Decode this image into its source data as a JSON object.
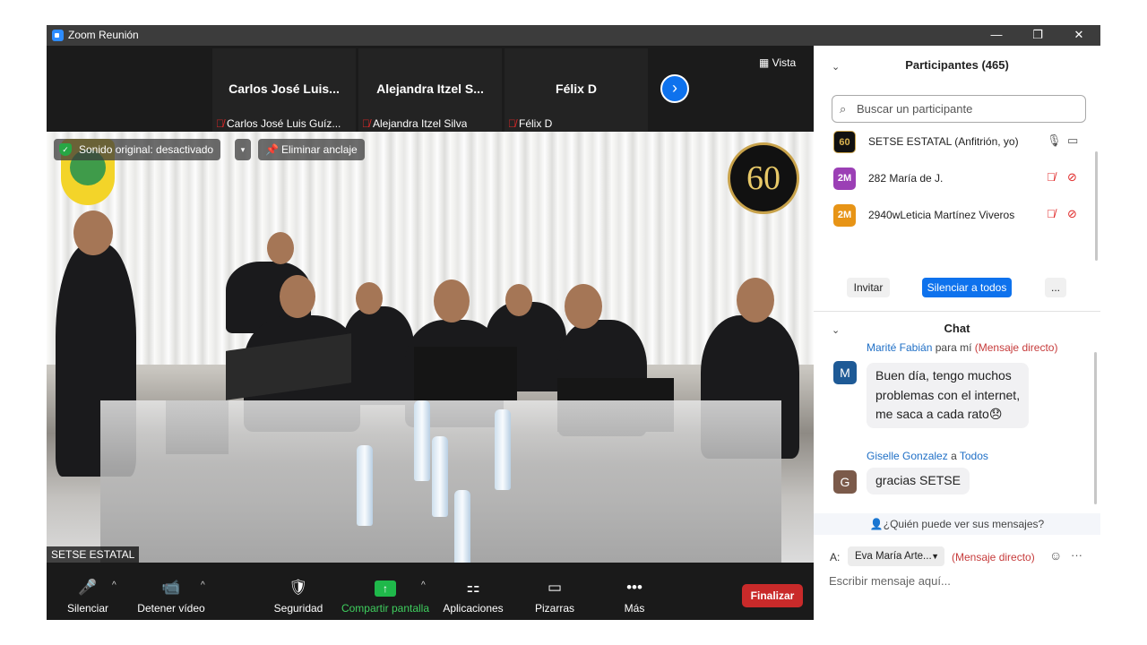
{
  "window": {
    "title": "Zoom Reunión",
    "minimize": "—",
    "maximize": "❐",
    "close": "✕"
  },
  "gallery": {
    "thumbnails": [
      {
        "name": "Carlos José Luis...",
        "label": "Carlos José Luis Guíz..."
      },
      {
        "name": "Alejandra Itzel S...",
        "label": "Alejandra Itzel Silva"
      },
      {
        "name": "Félix D",
        "label": "Félix D"
      }
    ],
    "next_arrow": "›",
    "view_button": "Vista"
  },
  "video": {
    "original_sound": "Sonido original: desactivado",
    "caret": "▾",
    "unpin": "Eliminar anclaje",
    "badge_text": "60",
    "speaker_name": "SETSE ESTATAL"
  },
  "toolbar": {
    "mute": "Silenciar",
    "stop_video": "Detener vídeo",
    "security": "Seguridad",
    "share_screen": "Compartir pantalla",
    "apps": "Aplicaciones",
    "whiteboards": "Pizarras",
    "more": "Más",
    "end": "Finalizar"
  },
  "participants": {
    "header": "Participantes (465)",
    "search_placeholder": "Buscar un participante",
    "list": [
      {
        "avatar": "60",
        "name": "SETSE ESTATAL (Anfitrión, yo)",
        "color": "#111111"
      },
      {
        "avatar": "2M",
        "name": "282 María de J.",
        "color": "#9b3fb5"
      },
      {
        "avatar": "2M",
        "name": "2940wLeticia Martínez Viveros",
        "color": "#e79416"
      }
    ],
    "invite": "Invitar",
    "mute_all": "Silenciar a todos",
    "more": "..."
  },
  "chat": {
    "header": "Chat",
    "messages": [
      {
        "sender": "Marité Fabián",
        "to": "para mí",
        "dm": "(Mensaje directo)",
        "avatar": "M",
        "avatar_color": "#1e5a96",
        "lines": [
          "Buen día, tengo muchos",
          "problemas con el internet,",
          "me saca a cada rato😞"
        ]
      },
      {
        "sender": "Giselle Gonzalez",
        "to": "a",
        "to_target": "Todos",
        "avatar": "G",
        "avatar_color": "#7b5a4a",
        "lines": [
          "gracias SETSE"
        ]
      }
    ],
    "who_sees": "¿Quién puede ver sus mensajes?",
    "to_label": "A:",
    "recipient": "Eva María Arte...",
    "recipient_mode": "(Mensaje directo)",
    "compose_placeholder": "Escribir mensaje aquí..."
  }
}
